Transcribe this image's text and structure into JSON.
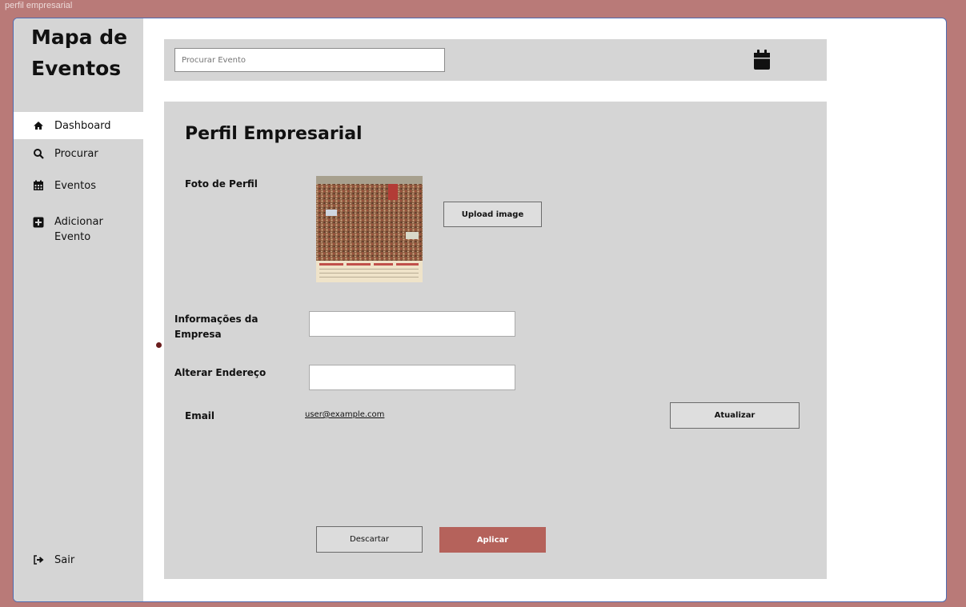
{
  "window": {
    "title": "perfil empresarial"
  },
  "sidebar": {
    "brand": "Mapa de Eventos",
    "items": [
      {
        "label": "Dashboard",
        "icon": "home-icon"
      },
      {
        "label": "Procurar",
        "icon": "search-icon"
      },
      {
        "label": "Eventos",
        "icon": "calendar-icon"
      },
      {
        "label": "Adicionar Evento",
        "icon": "plus-square-icon"
      }
    ],
    "logout": {
      "label": "Sair",
      "icon": "sign-out-icon"
    }
  },
  "header": {
    "search_placeholder": "Procurar Evento",
    "calendar_icon": "calendar-icon"
  },
  "main": {
    "title": "Perfil Empresarial",
    "photo_label": "Foto de Perfil",
    "upload_label": "Upload image",
    "company_info_label": "Informações da Empresa",
    "address_label": "Alterar Endereço",
    "email_label": "Email",
    "email_value": "user@example.com",
    "update_label": "Atualizar",
    "discard_label": "Descartar",
    "apply_label": "Aplicar"
  },
  "colors": {
    "background": "#b97a78",
    "panel": "#d5d5d5",
    "accent": "#b5625b"
  }
}
